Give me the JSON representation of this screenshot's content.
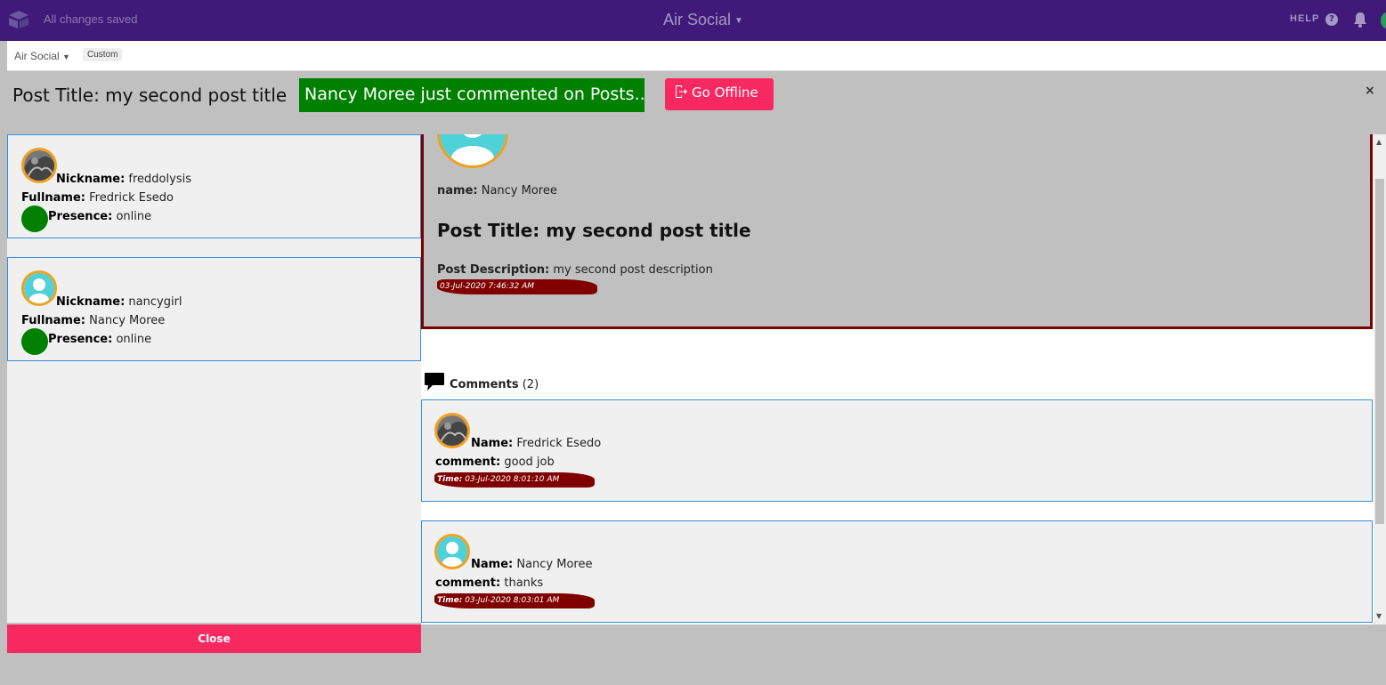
{
  "app": {
    "status": "All changes saved",
    "title": "Air Social",
    "help": "HELP",
    "help_icon": "?"
  },
  "subbar": {
    "base_name": "Air Social",
    "view_tag": "Custom"
  },
  "modal": {
    "header_title": "Post Title: my second post title",
    "notification": "Nancy Moree just commented on Posts...",
    "offline_label": "Go Offline",
    "close_x": "×",
    "close_label": "Close"
  },
  "users": [
    {
      "nickname_label": "Nickname:",
      "nickname": "freddolysis",
      "fullname_label": "Fullname:",
      "fullname": "Fredrick Esedo",
      "presence_label": "Presence:",
      "presence": "online",
      "avatar": "photo-avatar"
    },
    {
      "nickname_label": "Nickname:",
      "nickname": "nancygirl",
      "fullname_label": "Fullname:",
      "fullname": "Nancy Moree",
      "presence_label": "Presence:",
      "presence": "online",
      "avatar": "default-avatar"
    }
  ],
  "post": {
    "name_label": "name:",
    "name": "Nancy Moree",
    "title": "Post Title: my second post title",
    "description_label": "Post Description:",
    "description": "my second post description",
    "time": "03-Jul-2020 7:46:32 AM"
  },
  "comments": {
    "label": "Comments",
    "count": "(2)",
    "items": [
      {
        "name_label": "Name:",
        "name": "Fredrick Esedo",
        "comment_label": "comment:",
        "comment": "good job",
        "time_label": "Time:",
        "time": "03-Jul-2020 8:01:10 AM",
        "avatar": "photo-avatar"
      },
      {
        "name_label": "Name:",
        "name": "Nancy Moree",
        "comment_label": "comment:",
        "comment": "thanks",
        "time_label": "Time:",
        "time": "03-Jul-2020 8:03:01 AM",
        "avatar": "default-avatar"
      }
    ]
  },
  "colors": {
    "topbar": "#3f1a78",
    "accent_pink": "#f72960",
    "notice_green": "#008000",
    "time_maroon": "#800000",
    "avatar_ring": "#f0a020",
    "card_border": "#3a8fd6"
  }
}
